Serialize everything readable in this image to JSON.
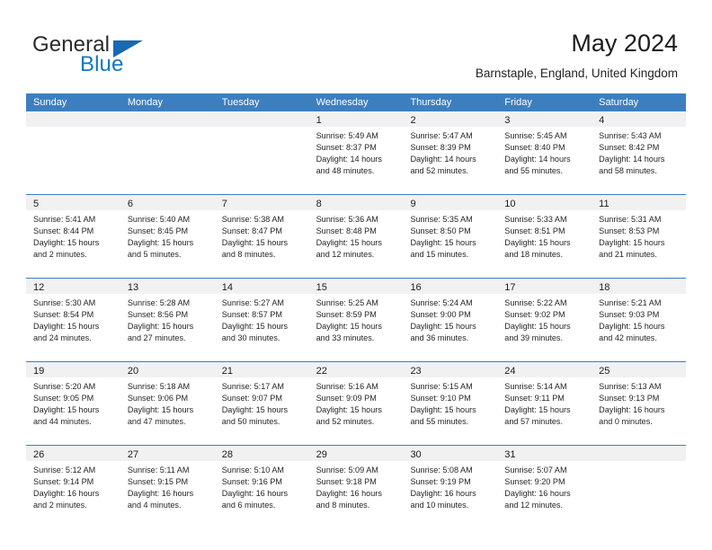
{
  "brand": {
    "line1": "General",
    "line2": "Blue",
    "flag_icon": "blue-flag-triangle-icon"
  },
  "header": {
    "title": "May 2024",
    "subtitle": "Barnstaple, England, United Kingdom"
  },
  "colors": {
    "header_blue": "#3c7fc1",
    "brand_blue": "#1278be",
    "flag_blue": "#1869b0",
    "date_band_gray": "#f1f1f1",
    "text": "#252525"
  },
  "calendar": {
    "day_names": [
      "Sunday",
      "Monday",
      "Tuesday",
      "Wednesday",
      "Thursday",
      "Friday",
      "Saturday"
    ],
    "weeks": [
      [
        {
          "day": "",
          "lines": []
        },
        {
          "day": "",
          "lines": []
        },
        {
          "day": "",
          "lines": []
        },
        {
          "day": "1",
          "lines": [
            "Sunrise: 5:49 AM",
            "Sunset: 8:37 PM",
            "Daylight: 14 hours",
            "and 48 minutes."
          ]
        },
        {
          "day": "2",
          "lines": [
            "Sunrise: 5:47 AM",
            "Sunset: 8:39 PM",
            "Daylight: 14 hours",
            "and 52 minutes."
          ]
        },
        {
          "day": "3",
          "lines": [
            "Sunrise: 5:45 AM",
            "Sunset: 8:40 PM",
            "Daylight: 14 hours",
            "and 55 minutes."
          ]
        },
        {
          "day": "4",
          "lines": [
            "Sunrise: 5:43 AM",
            "Sunset: 8:42 PM",
            "Daylight: 14 hours",
            "and 58 minutes."
          ]
        }
      ],
      [
        {
          "day": "5",
          "lines": [
            "Sunrise: 5:41 AM",
            "Sunset: 8:44 PM",
            "Daylight: 15 hours",
            "and 2 minutes."
          ]
        },
        {
          "day": "6",
          "lines": [
            "Sunrise: 5:40 AM",
            "Sunset: 8:45 PM",
            "Daylight: 15 hours",
            "and 5 minutes."
          ]
        },
        {
          "day": "7",
          "lines": [
            "Sunrise: 5:38 AM",
            "Sunset: 8:47 PM",
            "Daylight: 15 hours",
            "and 8 minutes."
          ]
        },
        {
          "day": "8",
          "lines": [
            "Sunrise: 5:36 AM",
            "Sunset: 8:48 PM",
            "Daylight: 15 hours",
            "and 12 minutes."
          ]
        },
        {
          "day": "9",
          "lines": [
            "Sunrise: 5:35 AM",
            "Sunset: 8:50 PM",
            "Daylight: 15 hours",
            "and 15 minutes."
          ]
        },
        {
          "day": "10",
          "lines": [
            "Sunrise: 5:33 AM",
            "Sunset: 8:51 PM",
            "Daylight: 15 hours",
            "and 18 minutes."
          ]
        },
        {
          "day": "11",
          "lines": [
            "Sunrise: 5:31 AM",
            "Sunset: 8:53 PM",
            "Daylight: 15 hours",
            "and 21 minutes."
          ]
        }
      ],
      [
        {
          "day": "12",
          "lines": [
            "Sunrise: 5:30 AM",
            "Sunset: 8:54 PM",
            "Daylight: 15 hours",
            "and 24 minutes."
          ]
        },
        {
          "day": "13",
          "lines": [
            "Sunrise: 5:28 AM",
            "Sunset: 8:56 PM",
            "Daylight: 15 hours",
            "and 27 minutes."
          ]
        },
        {
          "day": "14",
          "lines": [
            "Sunrise: 5:27 AM",
            "Sunset: 8:57 PM",
            "Daylight: 15 hours",
            "and 30 minutes."
          ]
        },
        {
          "day": "15",
          "lines": [
            "Sunrise: 5:25 AM",
            "Sunset: 8:59 PM",
            "Daylight: 15 hours",
            "and 33 minutes."
          ]
        },
        {
          "day": "16",
          "lines": [
            "Sunrise: 5:24 AM",
            "Sunset: 9:00 PM",
            "Daylight: 15 hours",
            "and 36 minutes."
          ]
        },
        {
          "day": "17",
          "lines": [
            "Sunrise: 5:22 AM",
            "Sunset: 9:02 PM",
            "Daylight: 15 hours",
            "and 39 minutes."
          ]
        },
        {
          "day": "18",
          "lines": [
            "Sunrise: 5:21 AM",
            "Sunset: 9:03 PM",
            "Daylight: 15 hours",
            "and 42 minutes."
          ]
        }
      ],
      [
        {
          "day": "19",
          "lines": [
            "Sunrise: 5:20 AM",
            "Sunset: 9:05 PM",
            "Daylight: 15 hours",
            "and 44 minutes."
          ]
        },
        {
          "day": "20",
          "lines": [
            "Sunrise: 5:18 AM",
            "Sunset: 9:06 PM",
            "Daylight: 15 hours",
            "and 47 minutes."
          ]
        },
        {
          "day": "21",
          "lines": [
            "Sunrise: 5:17 AM",
            "Sunset: 9:07 PM",
            "Daylight: 15 hours",
            "and 50 minutes."
          ]
        },
        {
          "day": "22",
          "lines": [
            "Sunrise: 5:16 AM",
            "Sunset: 9:09 PM",
            "Daylight: 15 hours",
            "and 52 minutes."
          ]
        },
        {
          "day": "23",
          "lines": [
            "Sunrise: 5:15 AM",
            "Sunset: 9:10 PM",
            "Daylight: 15 hours",
            "and 55 minutes."
          ]
        },
        {
          "day": "24",
          "lines": [
            "Sunrise: 5:14 AM",
            "Sunset: 9:11 PM",
            "Daylight: 15 hours",
            "and 57 minutes."
          ]
        },
        {
          "day": "25",
          "lines": [
            "Sunrise: 5:13 AM",
            "Sunset: 9:13 PM",
            "Daylight: 16 hours",
            "and 0 minutes."
          ]
        }
      ],
      [
        {
          "day": "26",
          "lines": [
            "Sunrise: 5:12 AM",
            "Sunset: 9:14 PM",
            "Daylight: 16 hours",
            "and 2 minutes."
          ]
        },
        {
          "day": "27",
          "lines": [
            "Sunrise: 5:11 AM",
            "Sunset: 9:15 PM",
            "Daylight: 16 hours",
            "and 4 minutes."
          ]
        },
        {
          "day": "28",
          "lines": [
            "Sunrise: 5:10 AM",
            "Sunset: 9:16 PM",
            "Daylight: 16 hours",
            "and 6 minutes."
          ]
        },
        {
          "day": "29",
          "lines": [
            "Sunrise: 5:09 AM",
            "Sunset: 9:18 PM",
            "Daylight: 16 hours",
            "and 8 minutes."
          ]
        },
        {
          "day": "30",
          "lines": [
            "Sunrise: 5:08 AM",
            "Sunset: 9:19 PM",
            "Daylight: 16 hours",
            "and 10 minutes."
          ]
        },
        {
          "day": "31",
          "lines": [
            "Sunrise: 5:07 AM",
            "Sunset: 9:20 PM",
            "Daylight: 16 hours",
            "and 12 minutes."
          ]
        },
        {
          "day": "",
          "lines": []
        }
      ]
    ]
  }
}
